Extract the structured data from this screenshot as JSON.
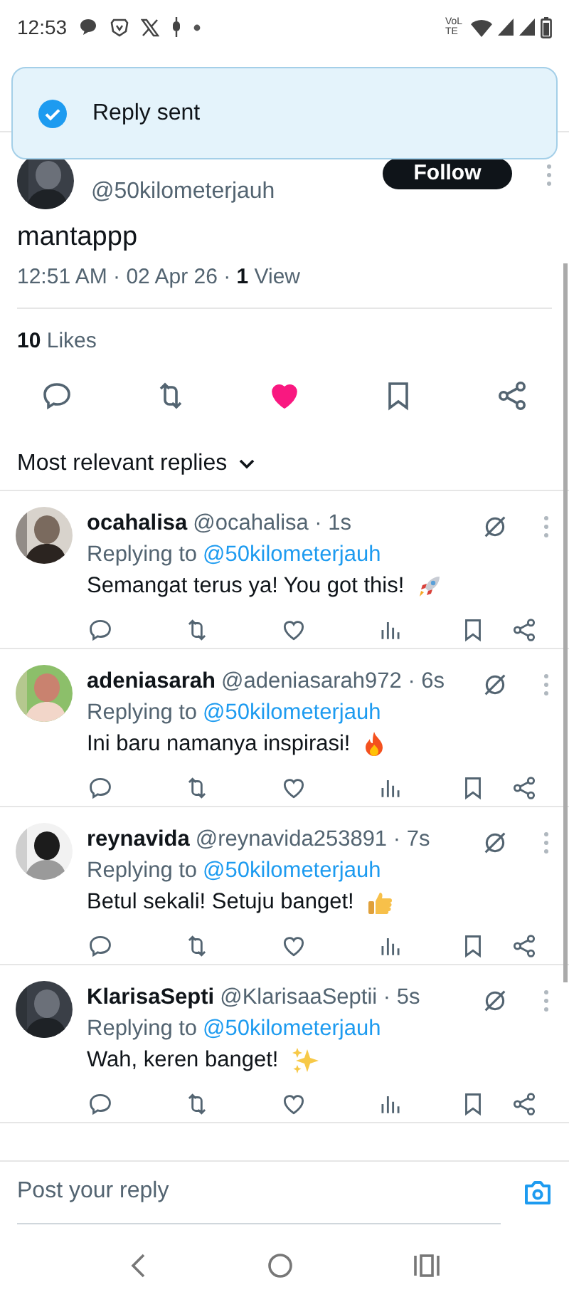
{
  "status_bar": {
    "time": "12:53",
    "network_label": "VoLTE"
  },
  "toast": {
    "message": "Reply sent"
  },
  "tweet": {
    "handle": "@50kilometerjauh",
    "follow_label": "Follow",
    "text": "mantappp",
    "meta": "12:51 AM · 02 Apr 26 · **1** View",
    "likes": "**10** Likes",
    "liked": true,
    "bookmarked": false
  },
  "sort": {
    "label": "Most relevant replies"
  },
  "replies": [
    {
      "name": "ocahalisa",
      "meta": "@ocahalisa · 1s",
      "replying_prefix": "Replying to",
      "replying_handle": "@50kilometerjauh",
      "text": "Semangat terus ya! You got this!",
      "kind": "rocket",
      "liked": false
    },
    {
      "name": "adeniasarah",
      "meta": "@adeniasarah972 · 6s",
      "replying_prefix": "Replying to",
      "replying_handle": "@50kilometerjauh",
      "text": "Ini baru namanya inspirasi!",
      "kind": "fire",
      "liked": false
    },
    {
      "name": "reynavida",
      "meta": "@reynavida253891 · 7s",
      "replying_prefix": "Replying to",
      "replying_handle": "@50kilometerjauh",
      "text": "Betul sekali! Setuju banget!",
      "kind": "thumbs-up",
      "liked": false
    },
    {
      "name": "KlarisaSepti",
      "meta": "@KlarisaaSeptii · 5s",
      "replying_prefix": "Replying to",
      "replying_handle": "@50kilometerjauh",
      "text": "Wah, keren banget!",
      "kind": "sparkles",
      "liked": false
    }
  ],
  "composer": {
    "placeholder": "Post your reply"
  }
}
